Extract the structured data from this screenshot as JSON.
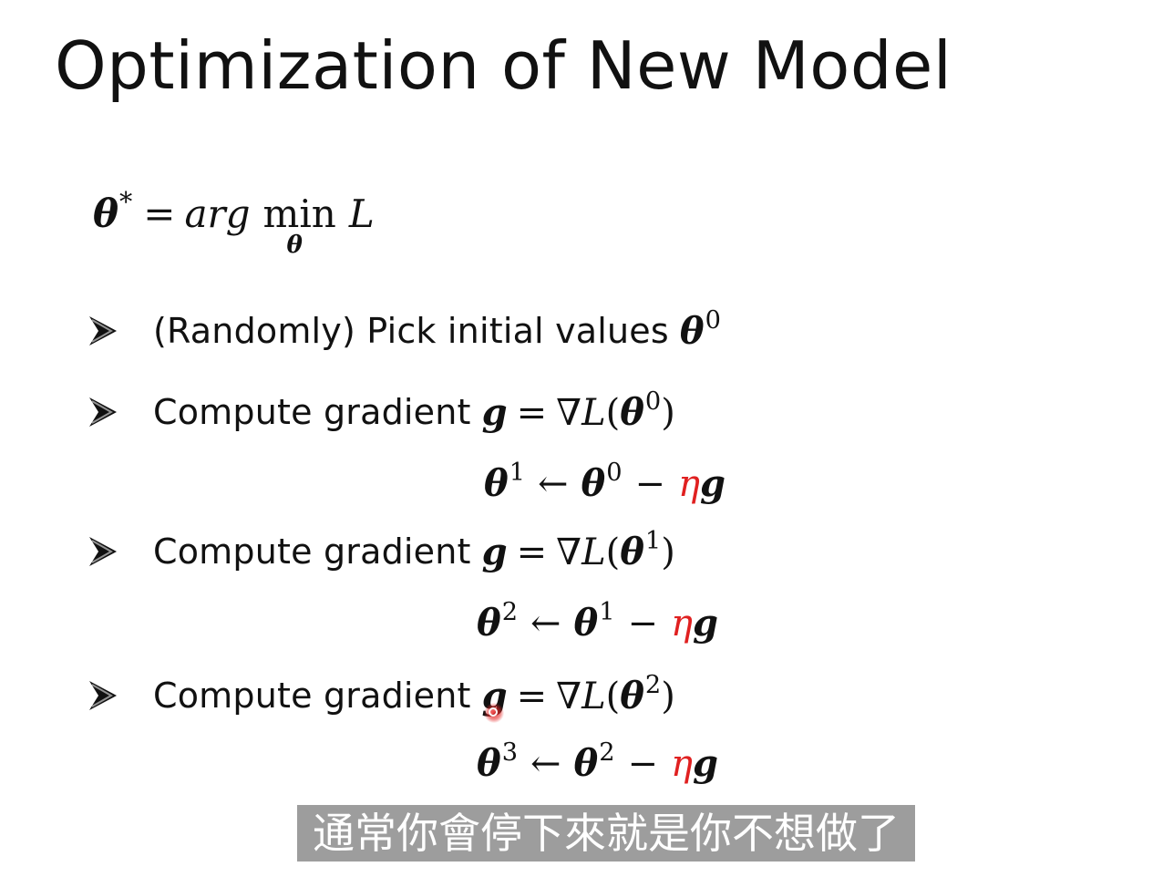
{
  "slide": {
    "title": "Optimization of New Model",
    "objective": {
      "lhs": "θ",
      "lhs_sup": "*",
      "eq": "=",
      "arg": "arg",
      "min": "min",
      "min_sub": "θ",
      "loss": "L"
    },
    "bullets": [
      {
        "text": "(Randomly) Pick initial values",
        "math": {
          "symbol": "θ",
          "sup": "0"
        }
      },
      {
        "text": "Compute gradient",
        "math": {
          "g": "g",
          "eq": "=",
          "nabla": "∇",
          "L": "L",
          "open": "(",
          "theta": "θ",
          "sup": "0",
          "close": ")"
        }
      },
      {
        "text": "Compute gradient",
        "math": {
          "g": "g",
          "eq": "=",
          "nabla": "∇",
          "L": "L",
          "open": "(",
          "theta": "θ",
          "sup": "1",
          "close": ")"
        }
      },
      {
        "text": "Compute gradient",
        "math": {
          "g": "g",
          "eq": "=",
          "nabla": "∇",
          "L": "L",
          "open": "(",
          "theta": "θ",
          "sup": "2",
          "close": ")"
        }
      }
    ],
    "updates": [
      {
        "lhs": "θ",
        "lhs_sup": "1",
        "arrow": "←",
        "rhs": "θ",
        "rhs_sup": "0",
        "minus": "−",
        "eta": "η",
        "g": "g"
      },
      {
        "lhs": "θ",
        "lhs_sup": "2",
        "arrow": "←",
        "rhs": "θ",
        "rhs_sup": "1",
        "minus": "−",
        "eta": "η",
        "g": "g"
      },
      {
        "lhs": "θ",
        "lhs_sup": "3",
        "arrow": "←",
        "rhs": "θ",
        "rhs_sup": "2",
        "minus": "−",
        "eta": "η",
        "g": "g"
      }
    ],
    "subtitle": "通常你會停下來就是你不想做了",
    "colors": {
      "text": "#111111",
      "eta": "#e02020",
      "subtitle_bg": "#8c8c8c",
      "subtitle_text": "#ffffff"
    },
    "icons": {
      "bullet": "arrowhead-bullet-icon",
      "cursor": "laser-pointer-icon"
    }
  }
}
